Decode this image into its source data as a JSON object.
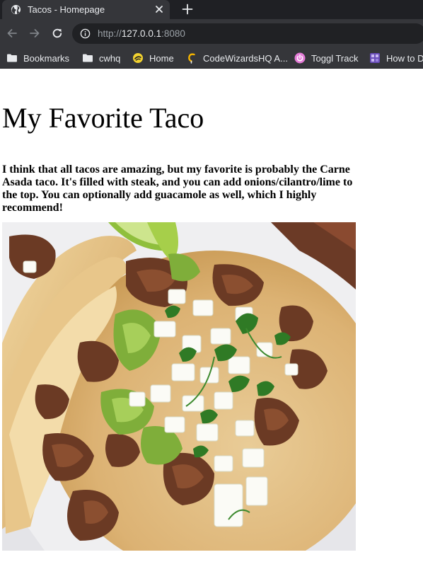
{
  "browser": {
    "tab": {
      "title": "Tacos - Homepage",
      "favicon": "globe-icon"
    },
    "address_bar": {
      "scheme": "http://",
      "host": "127.0.0.1",
      "port": ":8080"
    },
    "bookmarks": [
      {
        "label": "Bookmarks",
        "icon": "folder-icon"
      },
      {
        "label": "cwhq",
        "icon": "folder-icon"
      },
      {
        "label": "Home",
        "icon": "home-favicon"
      },
      {
        "label": "CodeWizardsHQ A...",
        "icon": "codewizards-favicon"
      },
      {
        "label": "Toggl Track",
        "icon": "toggl-favicon"
      },
      {
        "label": "How to D",
        "icon": "puzzle-favicon"
      }
    ]
  },
  "page": {
    "heading": "My Favorite Taco",
    "description": "I think that all tacos are amazing, but my favorite is probably the Carne Asada taco. It's filled with steak, and you can add onions/cilantro/lime to the top. You can optionally add guacamole as well, which I highly recommend!",
    "image": {
      "subject": "carne asada tacos topped with onion, cilantro, guacamole and lime"
    }
  },
  "colors": {
    "chrome_dark": "#1f2024",
    "chrome": "#35363a",
    "omnibox": "#202124",
    "chrome_text": "#e8eaed",
    "url_muted": "#9aa0a6",
    "page_bg": "#ffffff",
    "page_text": "#000000"
  }
}
